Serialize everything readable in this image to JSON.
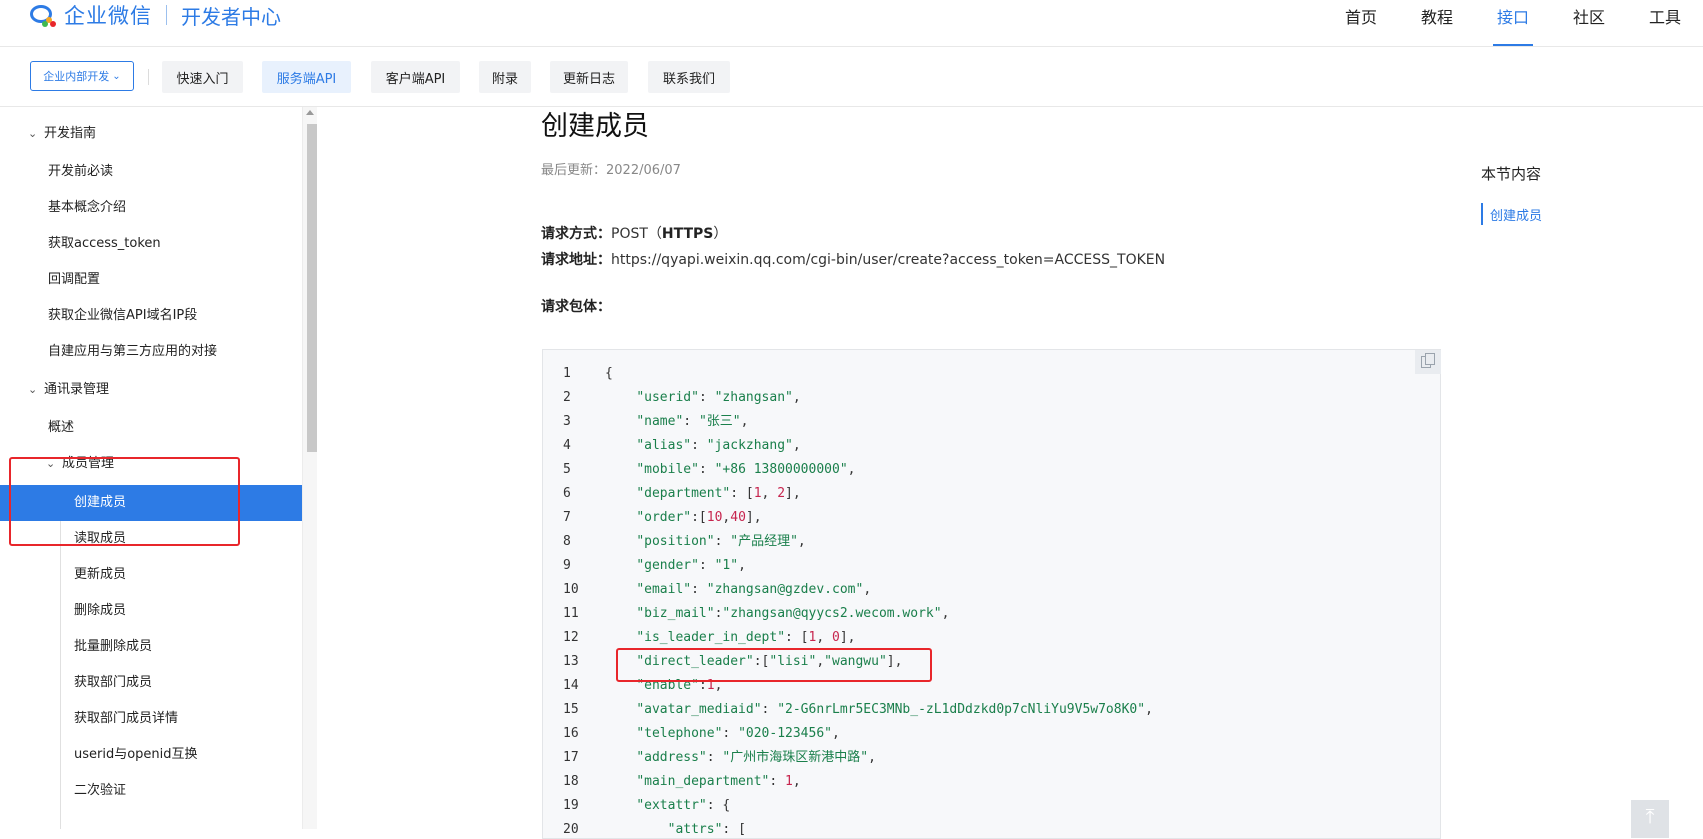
{
  "header": {
    "brand": "企业微信",
    "sub": "开发者中心",
    "nav": [
      "首页",
      "教程",
      "接口",
      "社区",
      "工具"
    ],
    "nav_active": "接口"
  },
  "subnav": {
    "dropdown": "企业内部开发",
    "pills": [
      "快速入门",
      "服务端API",
      "客户端API",
      "附录",
      "更新日志",
      "联系我们"
    ],
    "active": "服务端API"
  },
  "sidebar": {
    "items": [
      {
        "label": "开发指南",
        "type": "group"
      },
      {
        "label": "开发前必读"
      },
      {
        "label": "基本概念介绍"
      },
      {
        "label": "获取access_token"
      },
      {
        "label": "回调配置"
      },
      {
        "label": "获取企业微信API域名IP段"
      },
      {
        "label": "自建应用与第三方应用的对接"
      },
      {
        "label": "通讯录管理",
        "type": "group"
      },
      {
        "label": "概述"
      },
      {
        "label": "成员管理",
        "type": "subgroup"
      },
      {
        "label": "创建成员",
        "active": true
      },
      {
        "label": "读取成员"
      },
      {
        "label": "更新成员"
      },
      {
        "label": "删除成员"
      },
      {
        "label": "批量删除成员"
      },
      {
        "label": "获取部门成员"
      },
      {
        "label": "获取部门成员详情"
      },
      {
        "label": "userid与openid互换"
      },
      {
        "label": "二次验证"
      }
    ]
  },
  "article": {
    "title": "创建成员",
    "updated": "最后更新：2022/06/07",
    "method_label": "请求方式：",
    "method_value": "POST（",
    "method_proto": "HTTPS",
    "method_close": "）",
    "url_label": "请求地址：",
    "url_value": "https://qyapi.weixin.qq.com/cgi-bin/user/create?access_token=ACCESS_TOKEN",
    "body_label": "请求包体："
  },
  "code_lines": [
    {
      "n": "1",
      "t": "{"
    },
    {
      "n": "2",
      "t": "    \"userid\": \"zhangsan\","
    },
    {
      "n": "3",
      "t": "    \"name\": \"张三\","
    },
    {
      "n": "4",
      "t": "    \"alias\": \"jackzhang\","
    },
    {
      "n": "5",
      "t": "    \"mobile\": \"+86 13800000000\","
    },
    {
      "n": "6",
      "t": "    \"department\": [1, 2],"
    },
    {
      "n": "7",
      "t": "    \"order\":[10,40],"
    },
    {
      "n": "8",
      "t": "    \"position\": \"产品经理\","
    },
    {
      "n": "9",
      "t": "    \"gender\": \"1\","
    },
    {
      "n": "10",
      "t": "    \"email\": \"zhangsan@gzdev.com\","
    },
    {
      "n": "11",
      "t": "    \"biz_mail\":\"zhangsan@qyycs2.wecom.work\","
    },
    {
      "n": "12",
      "t": "    \"is_leader_in_dept\": [1, 0],"
    },
    {
      "n": "13",
      "t": "    \"direct_leader\":[\"lisi\",\"wangwu\"],"
    },
    {
      "n": "14",
      "t": "    \"enable\":1,"
    },
    {
      "n": "15",
      "t": "    \"avatar_mediaid\": \"2-G6nrLmr5EC3MNb_-zL1dDdzkd0p7cNliYu9V5w7o8K0\","
    },
    {
      "n": "16",
      "t": "    \"telephone\": \"020-123456\","
    },
    {
      "n": "17",
      "t": "    \"address\": \"广州市海珠区新港中路\","
    },
    {
      "n": "18",
      "t": "    \"main_department\": 1,"
    },
    {
      "n": "19",
      "t": "    \"extattr\": {"
    },
    {
      "n": "20",
      "t": "        \"attrs\": ["
    }
  ],
  "toc": {
    "title": "本节内容",
    "items": [
      "创建成员"
    ]
  },
  "colors": {
    "accent": "#2d7be5",
    "annotation": "#e8262b",
    "code_string": "#1a7f4b",
    "code_number": "#c7254e"
  }
}
